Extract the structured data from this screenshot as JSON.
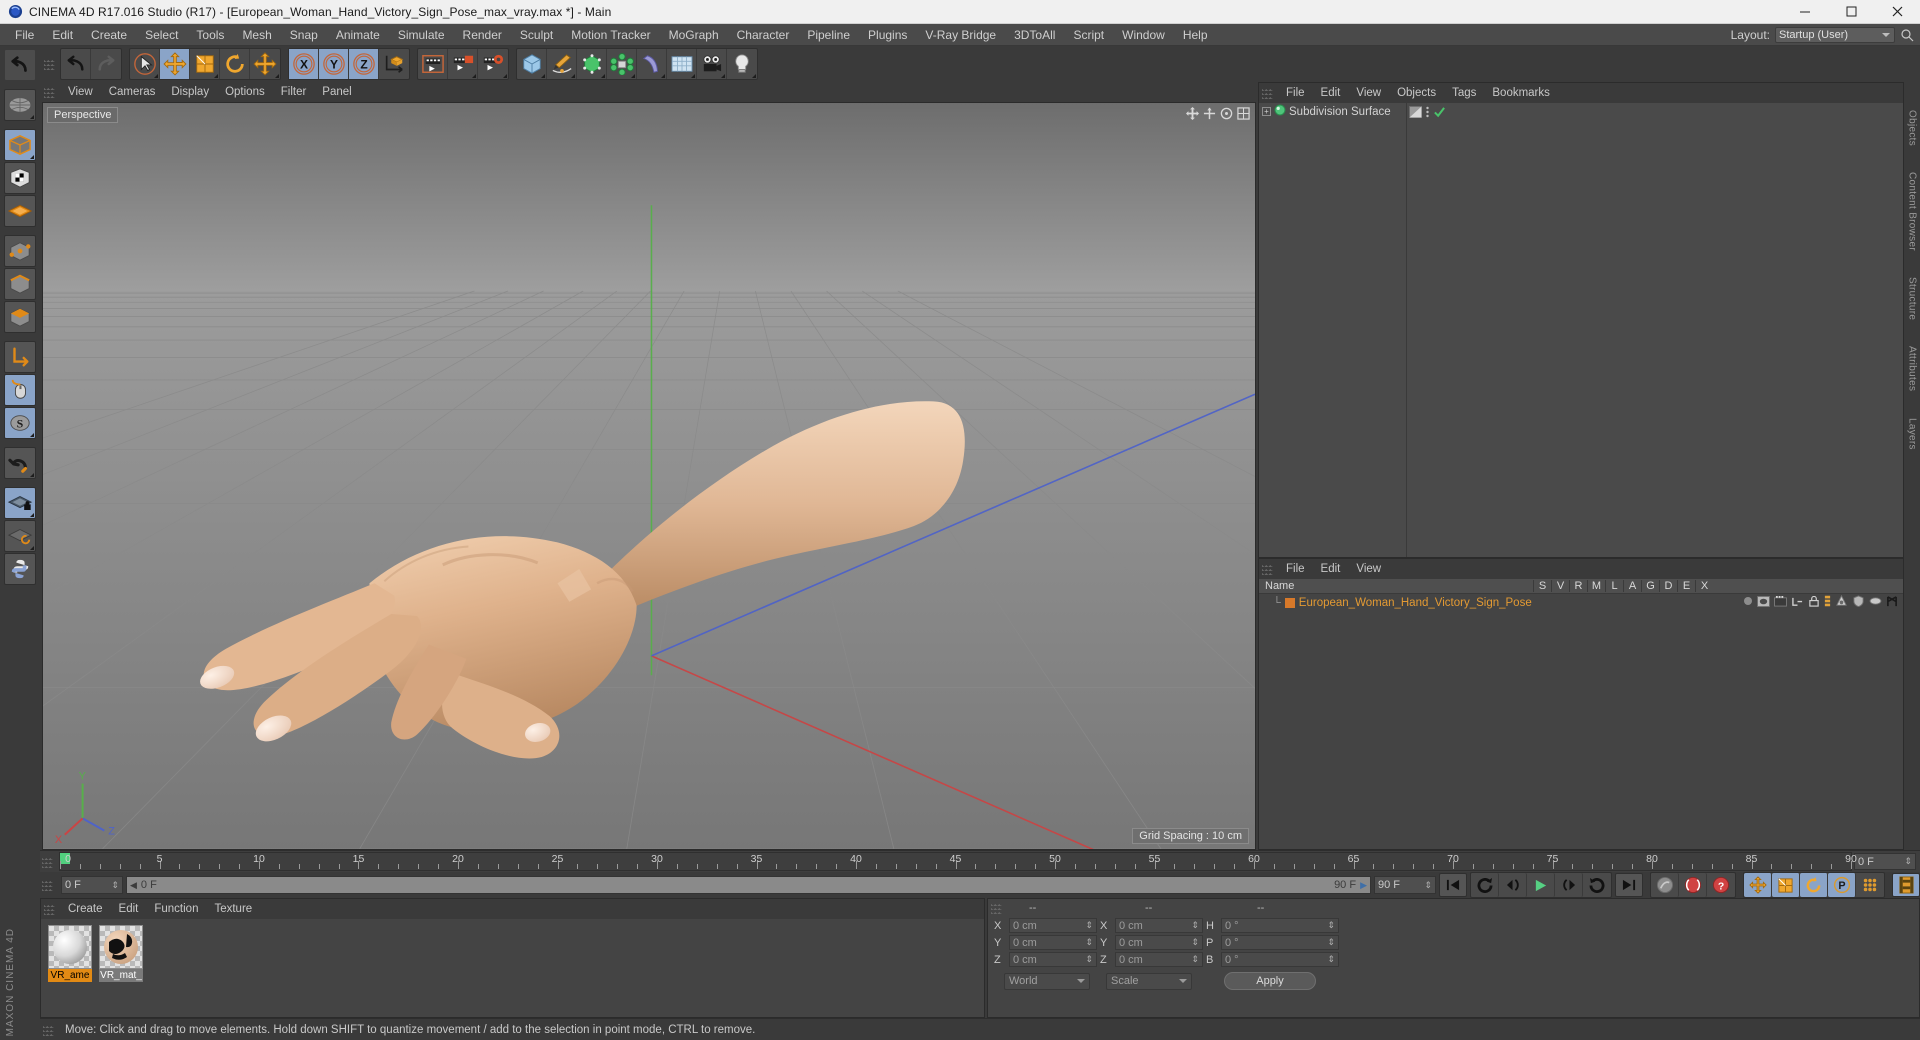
{
  "window": {
    "title": "CINEMA 4D R17.016 Studio (R17) - [European_Woman_Hand_Victory_Sign_Pose_max_vray.max *] - Main",
    "minimize": "minimize-button",
    "maximize": "maximize-button",
    "close": "close-button"
  },
  "menubar": {
    "items": [
      "File",
      "Edit",
      "Create",
      "Select",
      "Tools",
      "Mesh",
      "Snap",
      "Animate",
      "Simulate",
      "Render",
      "Sculpt",
      "Motion Tracker",
      "MoGraph",
      "Character",
      "Pipeline",
      "Plugins",
      "V-Ray Bridge",
      "3DToAll",
      "Script",
      "Window",
      "Help"
    ],
    "layout_label": "Layout:",
    "layout_value": "Startup (User)"
  },
  "left_toolbar": {
    "items": [
      {
        "name": "undo-tool",
        "active": false
      },
      {
        "name": "live-selection-globe-tool",
        "active": false
      },
      {
        "name": "model-mode-tool",
        "active": true
      },
      {
        "name": "texture-mode-tool",
        "active": false
      },
      {
        "name": "polygon-grid-tool",
        "active": false
      },
      {
        "name": "point-mode-tool",
        "active": false
      },
      {
        "name": "edge-mode-tool",
        "active": false
      },
      {
        "name": "polygon-mode-tool",
        "active": false
      },
      {
        "name": "axis-modification-tool",
        "active": false
      },
      {
        "name": "enable-axis-mouse-tool",
        "active": true
      },
      {
        "name": "enable-snap-tool",
        "active": true
      },
      {
        "name": "magnet-tool",
        "active": false
      },
      {
        "name": "lock-workplane-tool",
        "active": true
      },
      {
        "name": "planar-workplane-tool",
        "active": false
      },
      {
        "name": "python-tool",
        "active": false
      }
    ],
    "brand": "MAXON CINEMA 4D"
  },
  "top_toolbar": {
    "groups": [
      [
        {
          "name": "undo-button",
          "active": false
        },
        {
          "name": "redo-button",
          "active": false
        }
      ],
      [
        {
          "name": "live-selection-button",
          "active": false
        },
        {
          "name": "move-tool-button",
          "active": true
        },
        {
          "name": "scale-tool-button",
          "active": false
        },
        {
          "name": "rotate-tool-button",
          "active": false
        },
        {
          "name": "move-secondary-button",
          "active": false
        }
      ],
      [
        {
          "name": "x-axis-lock-button",
          "active": true
        },
        {
          "name": "y-axis-lock-button",
          "active": true
        },
        {
          "name": "z-axis-lock-button",
          "active": true
        },
        {
          "name": "world-object-coords-button",
          "active": false
        }
      ],
      [
        {
          "name": "render-view-button",
          "active": false
        },
        {
          "name": "render-region-button",
          "active": false
        },
        {
          "name": "render-to-picture-viewer-button",
          "active": false
        },
        {
          "name": "render-settings-button",
          "active": false
        }
      ],
      [
        {
          "name": "cube-primitive-button",
          "active": false
        },
        {
          "name": "spline-pen-button",
          "active": false
        },
        {
          "name": "nurbs-generator-button",
          "active": false
        },
        {
          "name": "array-deformer-button",
          "active": false
        },
        {
          "name": "bend-deformer-button",
          "active": false
        },
        {
          "name": "floor-environment-button",
          "active": false
        },
        {
          "name": "camera-button",
          "active": false
        },
        {
          "name": "light-button",
          "active": false
        }
      ]
    ]
  },
  "viewport": {
    "menu": [
      "View",
      "Cameras",
      "Display",
      "Options",
      "Filter",
      "Panel"
    ],
    "label": "Perspective",
    "grid_spacing": "Grid Spacing : 10 cm",
    "axis_gizmo": {
      "x": "X",
      "y": "Y",
      "z": "Z"
    },
    "nav_icons": [
      "move-camera-icon",
      "scale-camera-icon",
      "rotate-camera-icon",
      "maximize-viewport-icon"
    ]
  },
  "object_manager": {
    "menu": [
      "File",
      "Edit",
      "View",
      "Objects",
      "Tags",
      "Bookmarks"
    ],
    "tree_item": "Subdivision Surface",
    "columns": [
      "S",
      "V",
      "R",
      "M",
      "L",
      "A",
      "G",
      "D",
      "E",
      "X"
    ],
    "name_header": "Name",
    "rows": [
      {
        "name": "European_Woman_Hand_Victory_Sign_Pose"
      }
    ]
  },
  "attributes_panel": {
    "menu": [
      "File",
      "Edit",
      "View"
    ]
  },
  "right_tabs": [
    "Objects",
    "Content Browser",
    "Structure",
    "Attributes",
    "Layers"
  ],
  "timeline": {
    "ticks": [
      0,
      5,
      10,
      15,
      20,
      25,
      30,
      35,
      40,
      45,
      50,
      55,
      60,
      65,
      70,
      75,
      80,
      85,
      90
    ],
    "current_frame_field": "0 F",
    "min_frame": "0 F",
    "max_frame": "90 F",
    "preview_end": "90 F",
    "end_field": "90 F"
  },
  "playback": {
    "buttons": [
      {
        "name": "go-to-start-button",
        "active": false
      },
      {
        "name": "previous-key-button",
        "active": false
      },
      {
        "name": "step-back-button",
        "active": false
      },
      {
        "name": "play-button",
        "active": false
      },
      {
        "name": "step-forward-button",
        "active": false
      },
      {
        "name": "next-key-button",
        "active": false
      },
      {
        "name": "go-to-end-button",
        "active": false
      },
      {
        "name": "record-active-objects-button",
        "active": false
      },
      {
        "name": "autokeying-button",
        "active": false
      },
      {
        "name": "keyframe-selection-button",
        "active": false
      },
      {
        "name": "position-key-button",
        "active": true
      },
      {
        "name": "scale-key-button",
        "active": true
      },
      {
        "name": "rotation-key-button",
        "active": true
      },
      {
        "name": "parameter-key-button",
        "active": true
      },
      {
        "name": "point-level-animation-button",
        "active": false
      },
      {
        "name": "timeline-button",
        "active": true
      }
    ]
  },
  "material_manager": {
    "menu": [
      "Create",
      "Edit",
      "Function",
      "Texture"
    ],
    "materials": [
      {
        "name": "VR_ame",
        "selected": true
      },
      {
        "name": "VR_mat_",
        "selected": false
      }
    ]
  },
  "coordinates": {
    "headers": [
      "--",
      "--",
      "--"
    ],
    "position": {
      "x_label": "X",
      "x": "0 cm",
      "y_label": "Y",
      "y": "0 cm",
      "z_label": "Z",
      "z": "0 cm"
    },
    "size": {
      "x_label": "X",
      "x": "0 cm",
      "y_label": "Y",
      "y": "0 cm",
      "z_label": "Z",
      "z": "0 cm"
    },
    "rotation": {
      "h_label": "H",
      "h": "0 °",
      "p_label": "P",
      "p": "0 °",
      "b_label": "B",
      "b": "0 °"
    },
    "coord_system": "World",
    "size_mode": "Scale",
    "apply": "Apply"
  },
  "status_bar": {
    "message": "Move: Click and drag to move elements. Hold down SHIFT to quantize movement / add to the selection in point mode, CTRL to remove."
  },
  "colors": {
    "accent_orange": "#e28a14",
    "active_blue": "#8aa4c8",
    "panel_bg": "#3a3a3a",
    "skin": "#d9a983"
  }
}
